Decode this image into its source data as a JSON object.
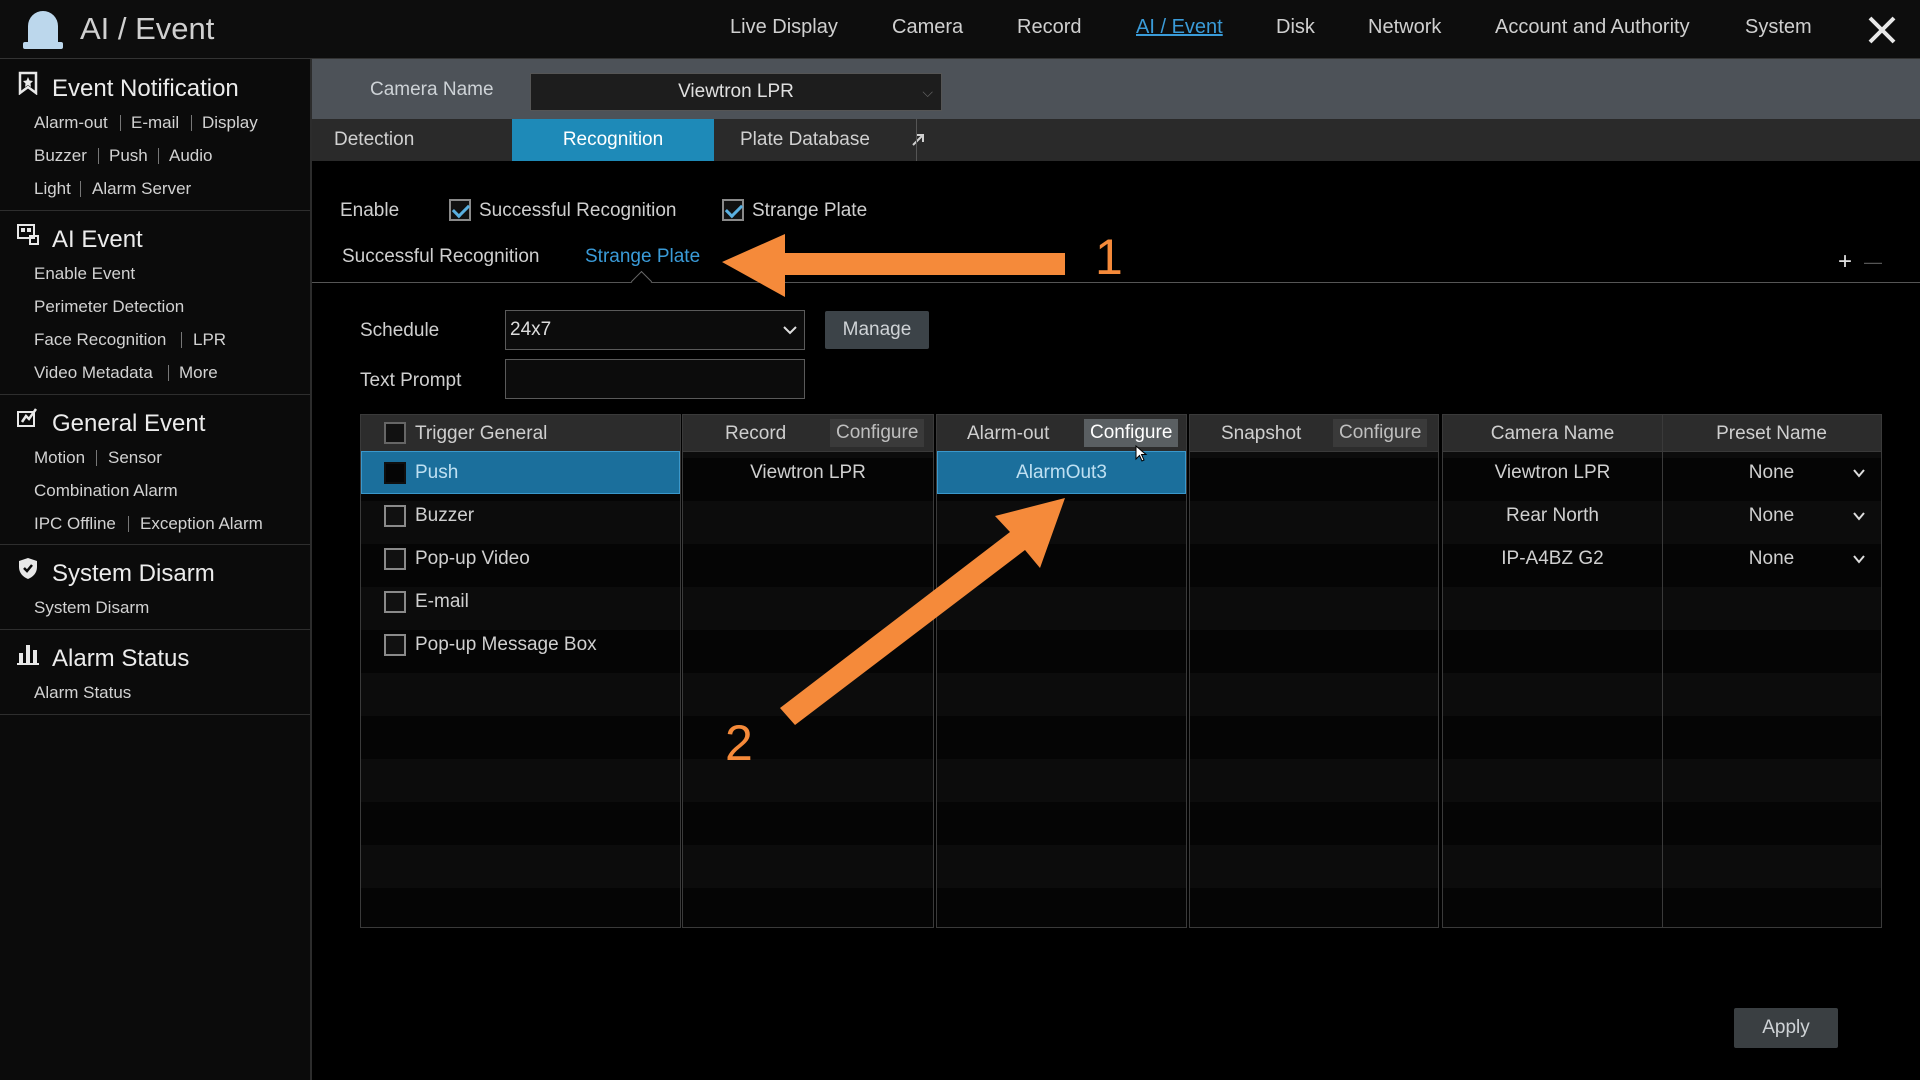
{
  "app": {
    "title": "AI / Event"
  },
  "nav": [
    "Live Display",
    "Camera",
    "Record",
    "AI / Event",
    "Disk",
    "Network",
    "Account and Authority",
    "System"
  ],
  "sidebar": {
    "event_notification": {
      "title": "Event Notification",
      "items": [
        "Alarm-out",
        "E-mail",
        "Display",
        "Buzzer",
        "Push",
        "Audio",
        "Light",
        "Alarm Server"
      ]
    },
    "ai_event": {
      "title": "AI Event",
      "items": [
        "Enable Event",
        "Perimeter Detection",
        "Face Recognition",
        "LPR",
        "Video Metadata",
        "More"
      ]
    },
    "general_event": {
      "title": "General Event",
      "items": [
        "Motion",
        "Sensor",
        "Combination Alarm",
        "IPC Offline",
        "Exception Alarm"
      ]
    },
    "system_disarm": {
      "title": "System Disarm",
      "items": [
        "System Disarm"
      ]
    },
    "alarm_status": {
      "title": "Alarm Status",
      "items": [
        "Alarm Status"
      ]
    }
  },
  "camera": {
    "label": "Camera Name",
    "value": "Viewtron LPR"
  },
  "tabs": [
    "Detection",
    "Recognition",
    "Plate Database"
  ],
  "enable": {
    "label": "Enable",
    "options": [
      {
        "label": "Successful Recognition",
        "checked": true
      },
      {
        "label": "Strange Plate",
        "checked": true
      }
    ]
  },
  "subtabs": [
    "Successful Recognition",
    "Strange Plate"
  ],
  "plus_minus": {
    "plus": "+",
    "minus": "—"
  },
  "schedule": {
    "label": "Schedule",
    "value": "24x7",
    "manage": "Manage"
  },
  "text_prompt": {
    "label": "Text Prompt",
    "value": ""
  },
  "trigger": {
    "header": "Trigger General",
    "items": [
      {
        "label": "Push",
        "checked": false,
        "selected": true
      },
      {
        "label": "Buzzer",
        "checked": false
      },
      {
        "label": "Pop-up Video",
        "checked": false
      },
      {
        "label": "E-mail",
        "checked": false
      },
      {
        "label": "Pop-up Message Box",
        "checked": false
      }
    ]
  },
  "record": {
    "header": "Record",
    "configure": "Configure",
    "items": [
      "Viewtron LPR"
    ]
  },
  "alarm_out": {
    "header": "Alarm-out",
    "configure": "Configure",
    "items": [
      "AlarmOut3"
    ]
  },
  "snapshot": {
    "header": "Snapshot",
    "configure": "Configure",
    "items": []
  },
  "preset": {
    "camera_header": "Camera Name",
    "preset_header": "Preset Name",
    "rows": [
      {
        "camera": "Viewtron LPR",
        "preset": "None"
      },
      {
        "camera": "Rear North",
        "preset": "None"
      },
      {
        "camera": "IP-A4BZ G2",
        "preset": "None"
      }
    ]
  },
  "apply": "Apply",
  "annotations": {
    "one": "1",
    "two": "2",
    "color": "#f58a3a"
  },
  "colors": {
    "accent": "#1e8ab8",
    "link": "#3a9bd8"
  }
}
